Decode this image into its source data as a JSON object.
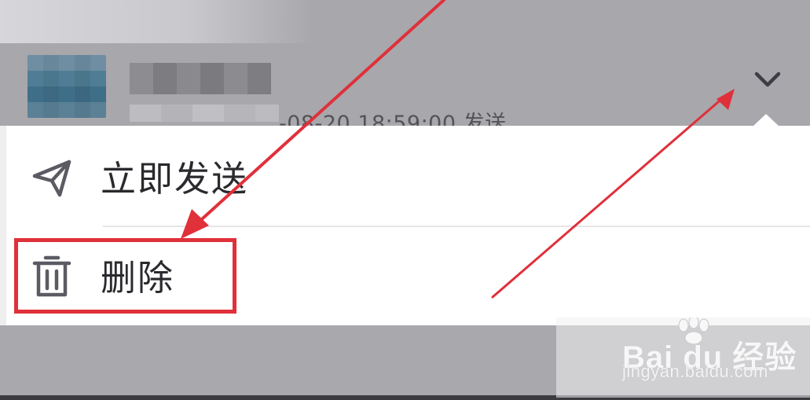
{
  "header": {
    "timestamp_text": "-08-20 18:59:00 发送",
    "dropdown_icon": "chevron-down-icon"
  },
  "menu": {
    "items": [
      {
        "icon": "paper-plane-icon",
        "label": "立即发送"
      },
      {
        "icon": "trash-icon",
        "label": "删除"
      }
    ]
  },
  "watermark": {
    "logo_text": "Bai du 经验",
    "url": "jingyan.baidu.com"
  },
  "colors": {
    "overlay_gray": "#a9a8ad",
    "menu_bg": "#ffffff",
    "menu_text": "#2a2a2e",
    "icon_gray": "#5b5b63",
    "annotation_red": "#e0303a"
  }
}
